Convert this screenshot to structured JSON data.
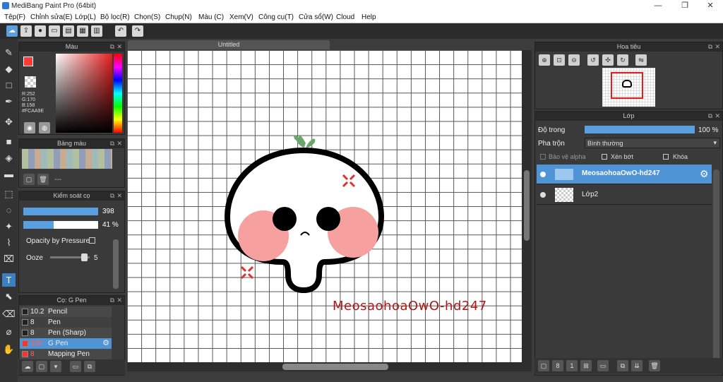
{
  "window": {
    "title": "MediBang Paint Pro (64bit)",
    "min": "—",
    "max": "❐",
    "close": "✕"
  },
  "menu": [
    "Tệp(F)",
    "Chỉnh sửa(E)",
    "Lớp(L)",
    "Bộ lọc(R)",
    "Chọn(S)",
    "Chụp(N)",
    "Màu (C)",
    "Xem(V)",
    "Công cụ(T)",
    "Cửa sổ(W)",
    "Cloud",
    "Help"
  ],
  "toolbar_icons": [
    "cloud-icon",
    "export-icon",
    "comment-icon",
    "text-frame-icon",
    "page-icon",
    "grid-icon",
    "panel-icon",
    "undo-icon",
    "redo-icon"
  ],
  "tools": [
    "brush-icon",
    "eraser-icon",
    "rectangle-icon",
    "pen-icon",
    "move-icon",
    "fill-rect-icon",
    "bucket-icon",
    "gradient-icon",
    "select-rect-icon",
    "lasso-icon",
    "magic-wand-icon",
    "select-pen-icon",
    "select-eraser-icon",
    "text-icon",
    "operation-icon",
    "eyedropper-icon",
    "dropper-icon",
    "hand-icon"
  ],
  "color_panel": {
    "title": "Màu",
    "r": "R:252",
    "g": "G:170",
    "b": "B:158",
    "hex": "#FCAA9E",
    "primary": "#FC3A3A"
  },
  "palette_panel": {
    "title": "Bảng màu",
    "placeholder": "---"
  },
  "brush_control": {
    "title": "Kiểm soát cọ",
    "size_value": "398",
    "opacity_value": "41",
    "opacity_unit": "%",
    "opacity_pressure_label": "Opacity by Pressure",
    "ooze_label": "Ooze",
    "ooze_value": "5",
    "size_fill": 1.0,
    "opacity_fill": 0.41,
    "ooze_fill": 0.85
  },
  "brush_list": {
    "title": "Cọ: G Pen",
    "items": [
      {
        "size": "10.2",
        "name": "Pencil",
        "color": "#222222",
        "selected": false
      },
      {
        "size": "8",
        "name": "Pen",
        "color": "#222222",
        "selected": false
      },
      {
        "size": "8",
        "name": "Pen (Sharp)",
        "color": "#222222",
        "selected": false
      },
      {
        "size": "398",
        "name": "G Pen",
        "color": "#ff3030",
        "selected": true
      },
      {
        "size": "8",
        "name": "Mapping Pen",
        "color": "#ff3030",
        "selected": false
      }
    ]
  },
  "canvas": {
    "tab": "Untitled",
    "watermark": "MeosaohoaOwO-hd247",
    "anger_color": "#e03030",
    "cheek_color": "#f7a0a0",
    "sprout_color": "#6aa56a"
  },
  "navigator": {
    "title": "Hoa tiêu"
  },
  "layers": {
    "title": "Lớp",
    "opacity_label": "Độ trong",
    "opacity_value": "100 %",
    "opacity_fill": 1.0,
    "blend_label": "Pha trộn",
    "blend_value": "Bình thường",
    "protect_alpha": "Bảo vệ alpha",
    "clipping": "Xén bớt",
    "lock": "Khóa",
    "items": [
      {
        "name": "MeosaohoaOwO-hd247",
        "selected": true
      },
      {
        "name": "Lớp2",
        "selected": false
      }
    ]
  }
}
